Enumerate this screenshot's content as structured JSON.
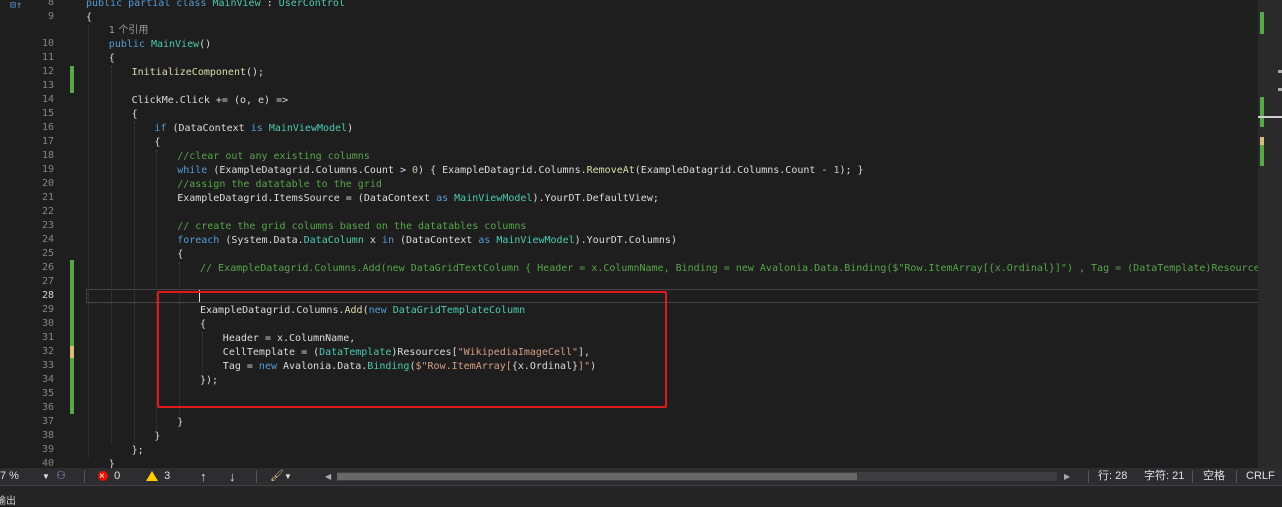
{
  "editor": {
    "line_numbers": [
      "8",
      "9",
      "10",
      "11",
      "12",
      "13",
      "14",
      "15",
      "16",
      "17",
      "18",
      "19",
      "20",
      "21",
      "22",
      "23",
      "24",
      "25",
      "26",
      "27",
      "28",
      "29",
      "30",
      "31",
      "32",
      "33",
      "34",
      "35",
      "36",
      "37",
      "38",
      "39",
      "40"
    ],
    "codelens": "1 个引用",
    "code": {
      "l8": [
        "public partial class ",
        "MainView",
        " : ",
        "UserControl"
      ],
      "l9": "{",
      "l10": [
        "public ",
        "MainView",
        "()"
      ],
      "l11": "{",
      "l12": [
        "InitializeComponent",
        "();"
      ],
      "l14": [
        "ClickMe.Click += (o, e) =>"
      ],
      "l15": "{",
      "l16": [
        "if",
        " (DataContext ",
        "is",
        " ",
        "MainViewModel",
        ")"
      ],
      "l17": "{",
      "l18": "//clear out any existing columns",
      "l19": [
        "while",
        " (ExampleDatagrid.Columns.Count > ",
        "0",
        ") { ExampleDatagrid.Columns.",
        "RemoveAt",
        "(ExampleDatagrid.Columns.Count - ",
        "1",
        "); }"
      ],
      "l20": "//assign the datatable to the grid",
      "l21": [
        "ExampleDatagrid.ItemsSource = (DataContext ",
        "as",
        " ",
        "MainViewModel",
        ").YourDT.DefaultView;"
      ],
      "l23": "// create the grid columns based on the datatables columns",
      "l24": [
        "foreach",
        " (System.Data.",
        "DataColumn",
        " x ",
        "in",
        " (DataContext ",
        "as",
        " ",
        "MainViewModel",
        ").YourDT.Columns)"
      ],
      "l25": "{",
      "l26": "// ExampleDatagrid.Columns.Add(new DataGridTextColumn { Header = x.ColumnName, Binding = new Avalonia.Data.Binding($\"Row.ItemArray[{x.Ordinal}]\") , Tag = (DataTemplate)Resources[\"Wikipedi",
      "l29": [
        "ExampleDatagrid.Columns.",
        "Add",
        "(",
        "new",
        " ",
        "DataGridTemplateColumn"
      ],
      "l30": "{",
      "l31": [
        "Header = x.ColumnName,"
      ],
      "l32": [
        "CellTemplate = (",
        "DataTemplate",
        ")Resources[",
        "\"WikipediaImageCell\"",
        "],"
      ],
      "l33": [
        "Tag = ",
        "new",
        " Avalonia.Data.",
        "Binding",
        "(",
        "$\"Row.ItemArray[",
        "{x.Ordinal}",
        "]\"",
        ")"
      ],
      "l34": "});",
      "l37": "}",
      "l38": "}",
      "l39": "};",
      "l40": "}"
    }
  },
  "statusbar": {
    "zoom": "7 %",
    "errors": "0",
    "warnings": "3",
    "row": "行: 28",
    "col": "字符: 21",
    "whitespace": "空格",
    "line_ending": "CRLF"
  },
  "output": {
    "label": "输出"
  },
  "colors": {
    "keyword": "#569cd6",
    "type": "#4ec9b0",
    "method": "#dcdcaa",
    "comment": "#57a64a",
    "string": "#d69d85",
    "highlight_box": "#e01a1a"
  }
}
